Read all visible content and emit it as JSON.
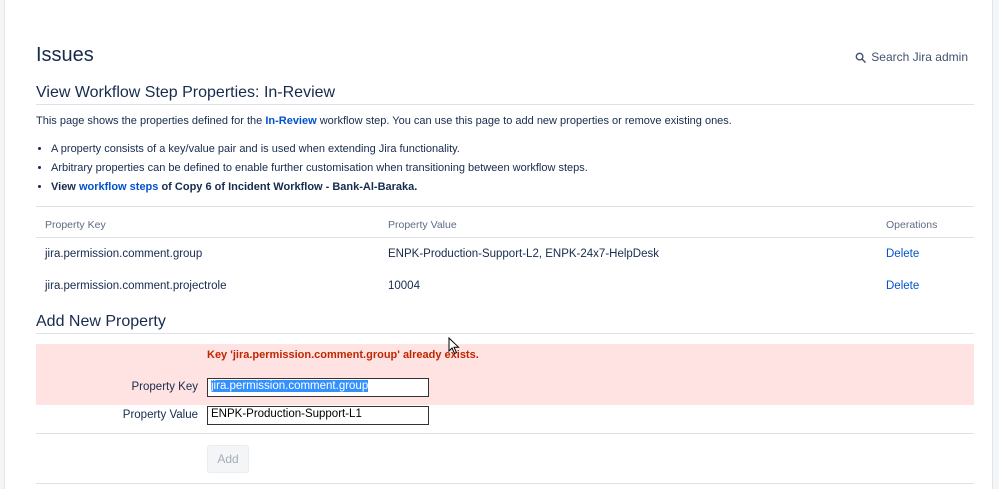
{
  "page": {
    "title": "Issues",
    "search_admin": "Search Jira admin"
  },
  "step": {
    "heading": "View Workflow Step Properties: In-Review",
    "desc_before": "This page shows the properties defined for the ",
    "desc_link": "In-Review",
    "desc_after": " workflow step. You can use this page to add new properties or remove existing ones.",
    "bullets": [
      "A property consists of a key/value pair and is used when extending Jira functionality.",
      "Arbitrary properties can be defined to enable further customisation when transitioning between workflow steps."
    ],
    "view_prefix": "View ",
    "view_link": "workflow steps",
    "view_suffix": " of Copy 6 of Incident Workflow - Bank-Al-Baraka."
  },
  "table": {
    "headers": [
      "Property Key",
      "Property Value",
      "Operations"
    ],
    "rows": [
      {
        "key": "jira.permission.comment.group",
        "value": "ENPK-Production-Support-L2, ENPK-24x7-HelpDesk",
        "op": "Delete"
      },
      {
        "key": "jira.permission.comment.projectrole",
        "value": "10004",
        "op": "Delete"
      }
    ]
  },
  "add_form": {
    "heading": "Add New Property",
    "error": "Key 'jira.permission.comment.group' already exists.",
    "key_label": "Property Key",
    "key_value": "jira.permission.comment.group",
    "value_label": "Property Value",
    "value_value": "ENPK-Production-Support-L1",
    "add_button": "Add"
  },
  "colors": {
    "link": "#0052cc",
    "error_bg": "#ffe3e3",
    "error_text": "#bf2600",
    "selection": "#3390ff"
  }
}
